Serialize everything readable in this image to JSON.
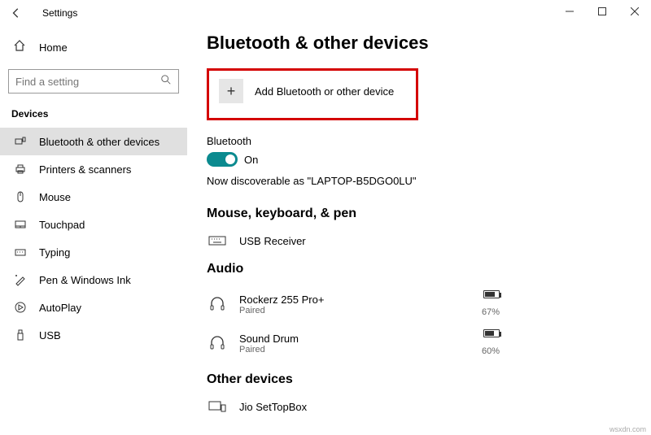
{
  "window": {
    "title": "Settings"
  },
  "sidebar": {
    "home_label": "Home",
    "search_placeholder": "Find a setting",
    "section_header": "Devices",
    "items": [
      {
        "label": "Bluetooth & other devices"
      },
      {
        "label": "Printers & scanners"
      },
      {
        "label": "Mouse"
      },
      {
        "label": "Touchpad"
      },
      {
        "label": "Typing"
      },
      {
        "label": "Pen & Windows Ink"
      },
      {
        "label": "AutoPlay"
      },
      {
        "label": "USB"
      }
    ]
  },
  "content": {
    "heading": "Bluetooth & other devices",
    "add_label": "Add Bluetooth or other device",
    "bluetooth_label": "Bluetooth",
    "toggle_state": "On",
    "discoverable_text": "Now discoverable as \"LAPTOP-B5DGO0LU\"",
    "group_mouse": "Mouse, keyboard, & pen",
    "usb_receiver": "USB Receiver",
    "group_audio": "Audio",
    "audio_devices": [
      {
        "name": "Rockerz 255 Pro+",
        "status": "Paired",
        "battery": "67%"
      },
      {
        "name": "Sound Drum",
        "status": "Paired",
        "battery": "60%"
      }
    ],
    "group_other": "Other devices",
    "other_device": "Jio SetTopBox"
  },
  "watermark": "wsxdn.com"
}
